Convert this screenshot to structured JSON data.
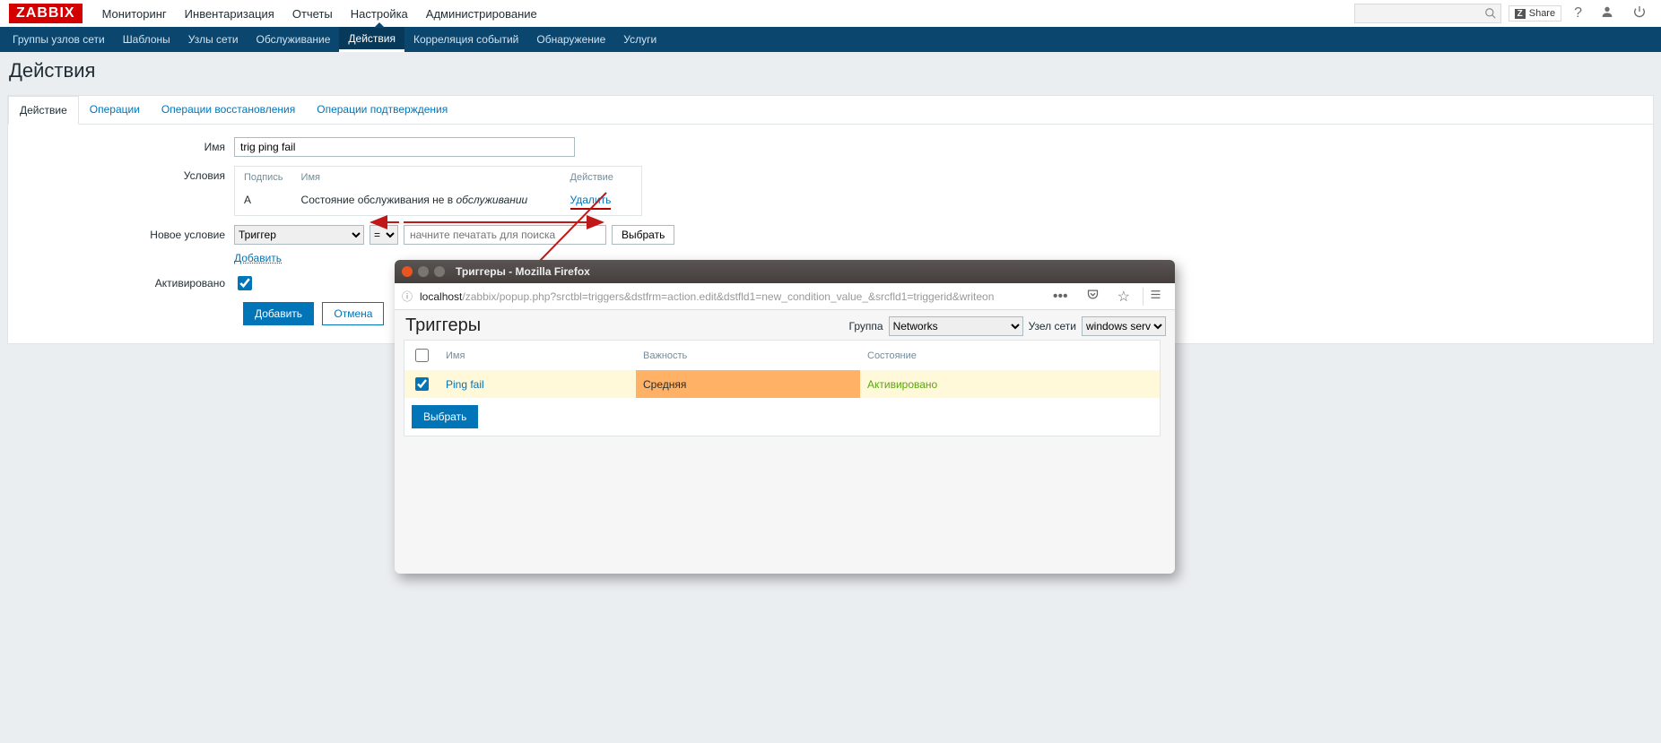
{
  "logo": "ZABBIX",
  "topnav": {
    "items": [
      "Мониторинг",
      "Инвентаризация",
      "Отчеты",
      "Настройка",
      "Администрирование"
    ],
    "active_index": 3
  },
  "share_label": "Share",
  "subnav": {
    "items": [
      "Группы узлов сети",
      "Шаблоны",
      "Узлы сети",
      "Обслуживание",
      "Действия",
      "Корреляция событий",
      "Обнаружение",
      "Услуги"
    ],
    "active_index": 4
  },
  "page_title": "Действия",
  "tabs": {
    "items": [
      "Действие",
      "Операции",
      "Операции восстановления",
      "Операции подтверждения"
    ],
    "active_index": 0
  },
  "form": {
    "labels": {
      "name": "Имя",
      "conditions": "Условия",
      "new_condition": "Новое условие",
      "enabled": "Активировано"
    },
    "name_value": "trig ping fail",
    "conditions": {
      "headers": {
        "label": "Подпись",
        "name": "Имя",
        "action": "Действие"
      },
      "rows": [
        {
          "label": "A",
          "name_prefix": "Состояние обслуживания не в ",
          "name_italic": "обслуживании",
          "action": "Удалить"
        }
      ]
    },
    "new_condition": {
      "type_option": "Триггер",
      "op_option": "=",
      "search_placeholder": "начните печатать для поиска",
      "select_button": "Выбрать"
    },
    "add_link": "Добавить",
    "buttons": {
      "add": "Добавить",
      "cancel": "Отмена"
    }
  },
  "popup": {
    "window_title": "Триггеры - Mozilla Firefox",
    "url_host": "localhost",
    "url_rest": "/zabbix/popup.php?srctbl=triggers&dstfrm=action.edit&dstfld1=new_condition_value_&srcfld1=triggerid&writeon",
    "title": "Триггеры",
    "group_label": "Группа",
    "group_value": "Networks",
    "host_label": "Узел сети",
    "host_value": "windows server",
    "table": {
      "headers": {
        "name": "Имя",
        "severity": "Важность",
        "state": "Состояние"
      },
      "row": {
        "name": "Ping fail",
        "severity": "Средняя",
        "state": "Активировано"
      },
      "select_button": "Выбрать"
    }
  }
}
